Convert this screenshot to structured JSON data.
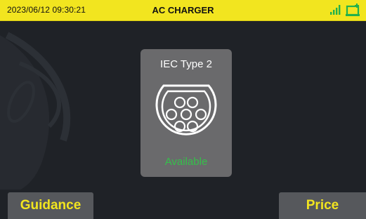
{
  "header": {
    "datetime": "2023/06/12  09:30:21",
    "title": "AC CHARGER",
    "accent_color": "#f2e51f",
    "signal_icon": "signal-bars-icon",
    "status_icon": "charger-status-icon",
    "status_icon_color": "#22b14c"
  },
  "connector": {
    "name": "IEC Type 2",
    "icon": "iec-type2-plug-icon",
    "status": "Available",
    "status_color": "#35c04a"
  },
  "buttons": {
    "guidance_label": "Guidance",
    "price_label": "Price"
  }
}
